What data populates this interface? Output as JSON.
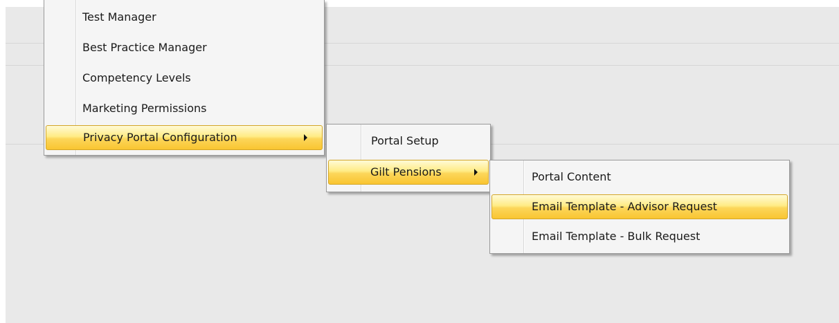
{
  "main_menu": {
    "items": [
      {
        "label": "Test Manager"
      },
      {
        "label": "Best Practice Manager"
      },
      {
        "label": "Competency Levels"
      },
      {
        "label": "Marketing Permissions"
      },
      {
        "label": "Privacy Portal Configuration",
        "has_submenu": true,
        "highlighted": true
      }
    ]
  },
  "privacy_submenu": {
    "items": [
      {
        "label": "Portal Setup"
      },
      {
        "label": "Gilt Pensions",
        "has_submenu": true,
        "highlighted": true
      }
    ]
  },
  "gilt_submenu": {
    "items": [
      {
        "label": "Portal Content"
      },
      {
        "label": "Email Template - Advisor Request",
        "highlighted": true
      },
      {
        "label": "Email Template - Bulk Request"
      }
    ]
  },
  "colors": {
    "highlight": "#fcd65a",
    "menu_background": "#f5f5f5",
    "canvas_background": "#e9e9e9"
  }
}
